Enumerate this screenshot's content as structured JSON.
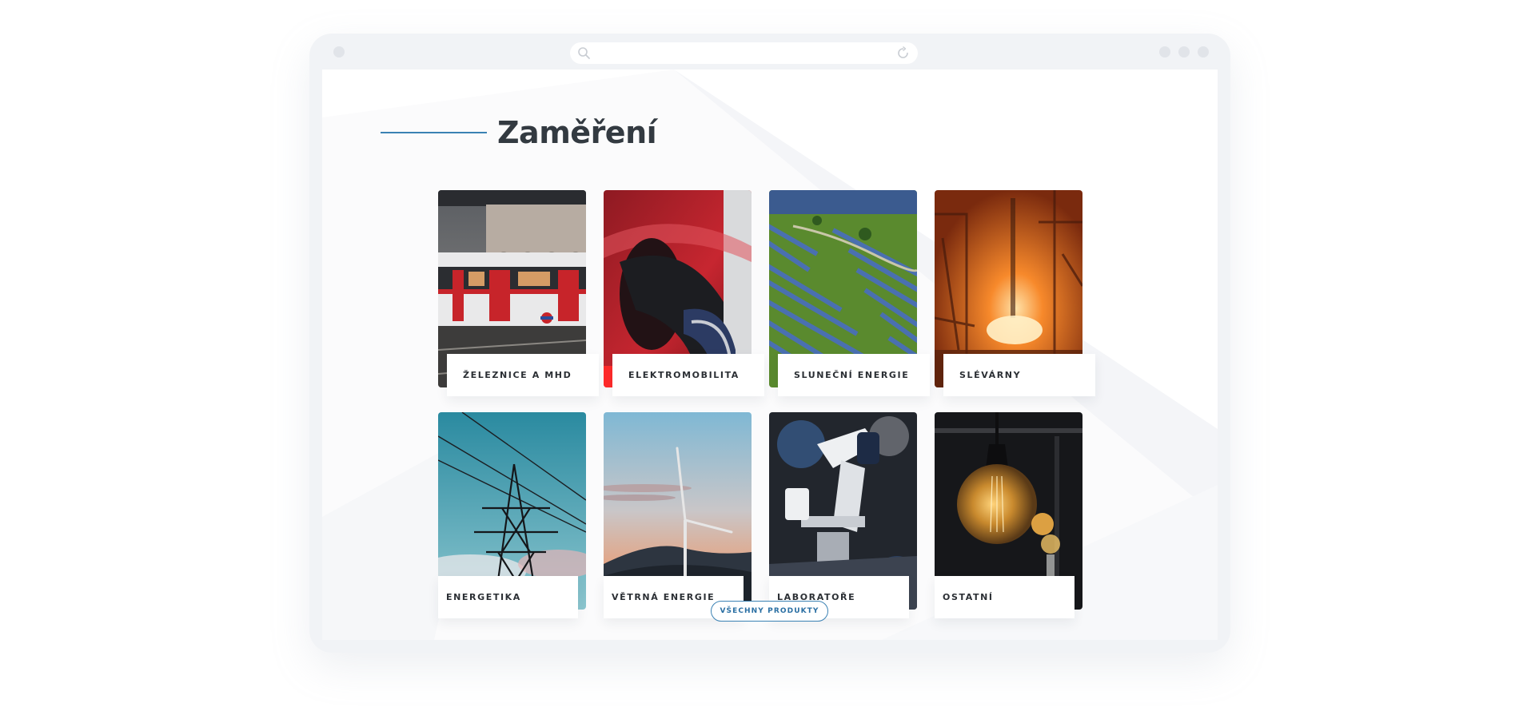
{
  "section": {
    "title": "Zaměření"
  },
  "cards": [
    {
      "label": "ŽELEZNICE A MHD",
      "icon": "train-photo"
    },
    {
      "label": "ELEKTROMOBILITA",
      "icon": "ev-charging-photo"
    },
    {
      "label": "SLUNEČNÍ ENERGIE",
      "icon": "solar-field-photo"
    },
    {
      "label": "SLÉVÁRNY",
      "icon": "foundry-photo"
    },
    {
      "label": "ENERGETIKA",
      "icon": "power-pylon-photo"
    },
    {
      "label": "VĚTRNÁ ENERGIE",
      "icon": "wind-turbine-photo"
    },
    {
      "label": "LABORATOŘE",
      "icon": "microscope-photo"
    },
    {
      "label": "OSTATNÍ",
      "icon": "light-bulb-photo"
    }
  ],
  "button": {
    "label": "VŠECHNY PRODUKTY"
  },
  "colors": {
    "accent": "#3b82b4",
    "title": "#333a41",
    "frame": "#f1f3f6"
  }
}
